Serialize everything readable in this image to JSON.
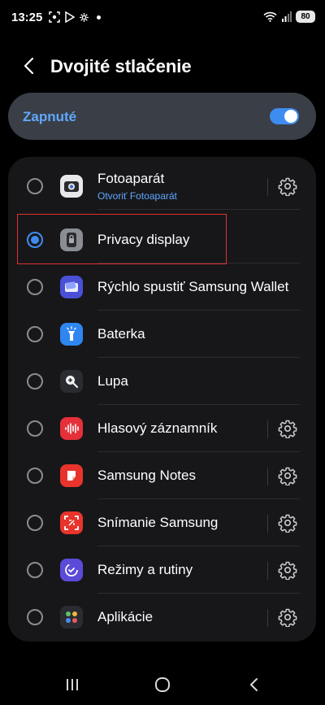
{
  "status_bar": {
    "time": "13:25",
    "battery": "80"
  },
  "header": {
    "title": "Dvojité stlačenie"
  },
  "master_toggle": {
    "label": "Zapnuté",
    "on": true
  },
  "items": [
    {
      "label": "Fotoaparát",
      "sublabel": "Otvoriť Fotoaparát",
      "icon": "camera-icon",
      "selected": false,
      "has_settings": true
    },
    {
      "label": "Privacy display",
      "icon": "privacy-display-icon",
      "selected": true,
      "has_settings": false
    },
    {
      "label": "Rýchlo spustiť Samsung Wallet",
      "icon": "wallet-icon",
      "selected": false,
      "has_settings": false
    },
    {
      "label": "Baterka",
      "icon": "flashlight-icon",
      "selected": false,
      "has_settings": false
    },
    {
      "label": "Lupa",
      "icon": "magnifier-icon",
      "selected": false,
      "has_settings": false
    },
    {
      "label": "Hlasový záznamník",
      "icon": "voice-recorder-icon",
      "selected": false,
      "has_settings": true
    },
    {
      "label": "Samsung Notes",
      "icon": "notes-icon",
      "selected": false,
      "has_settings": true
    },
    {
      "label": "Snímanie Samsung",
      "icon": "screen-capture-icon",
      "selected": false,
      "has_settings": true
    },
    {
      "label": "Režimy a rutiny",
      "icon": "modes-routines-icon",
      "selected": false,
      "has_settings": true
    },
    {
      "label": "Aplikácie",
      "icon": "apps-icon",
      "selected": false,
      "has_settings": true
    }
  ],
  "colors": {
    "accent": "#3f8cf0",
    "link": "#5fa8ff",
    "highlight": "#e03030"
  }
}
